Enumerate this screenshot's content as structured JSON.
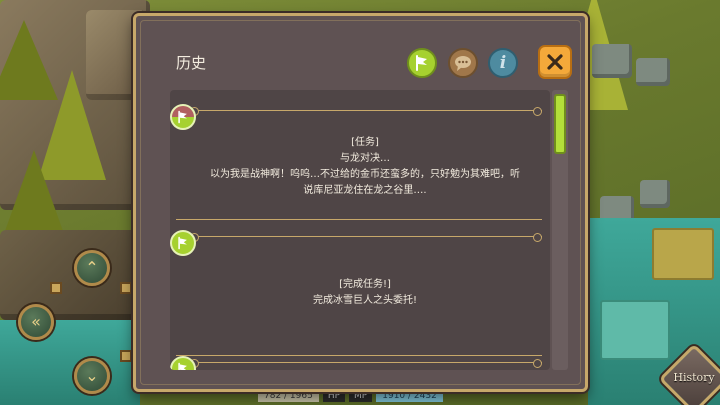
{
  "hud": {
    "left_buttons": [
      {
        "icon": "double-chevron-up-icon",
        "glyph": "⌃"
      },
      {
        "icon": "double-chevron-left-icon",
        "glyph": "«"
      },
      {
        "icon": "double-chevron-down-icon",
        "glyph": "⌄"
      }
    ],
    "stats": {
      "hp_value": "782 / 1965",
      "hp_label": "HP",
      "mp_label": "MP",
      "mp_value": "1910 / 2432"
    },
    "history_button_label": "History"
  },
  "panel": {
    "title": "历史",
    "header_icons": [
      {
        "name": "quest-flag-icon",
        "color": "#a6d12f"
      },
      {
        "name": "chat-bubble-icon",
        "color": "#a0774a"
      },
      {
        "name": "info-icon",
        "glyph": "i",
        "color": "#4e8ba0"
      }
    ],
    "close_icon": "close-icon",
    "entries": [
      {
        "icon": "quest-flag-icon",
        "lines": [
          "[任务]",
          "与龙对决…",
          "以为我是战神啊！呜呜…不过给的金币还蛮多的，只好勉为其难吧，听",
          "说库尼亚龙住在龙之谷里…."
        ]
      },
      {
        "icon": "quest-flag-icon",
        "lines": [
          "[完成任务!]",
          "完成冰雪巨人之头委托!"
        ]
      },
      {
        "icon": "quest-flag-icon",
        "lines": []
      }
    ]
  },
  "scroll": {
    "position_fraction": 0.0
  }
}
